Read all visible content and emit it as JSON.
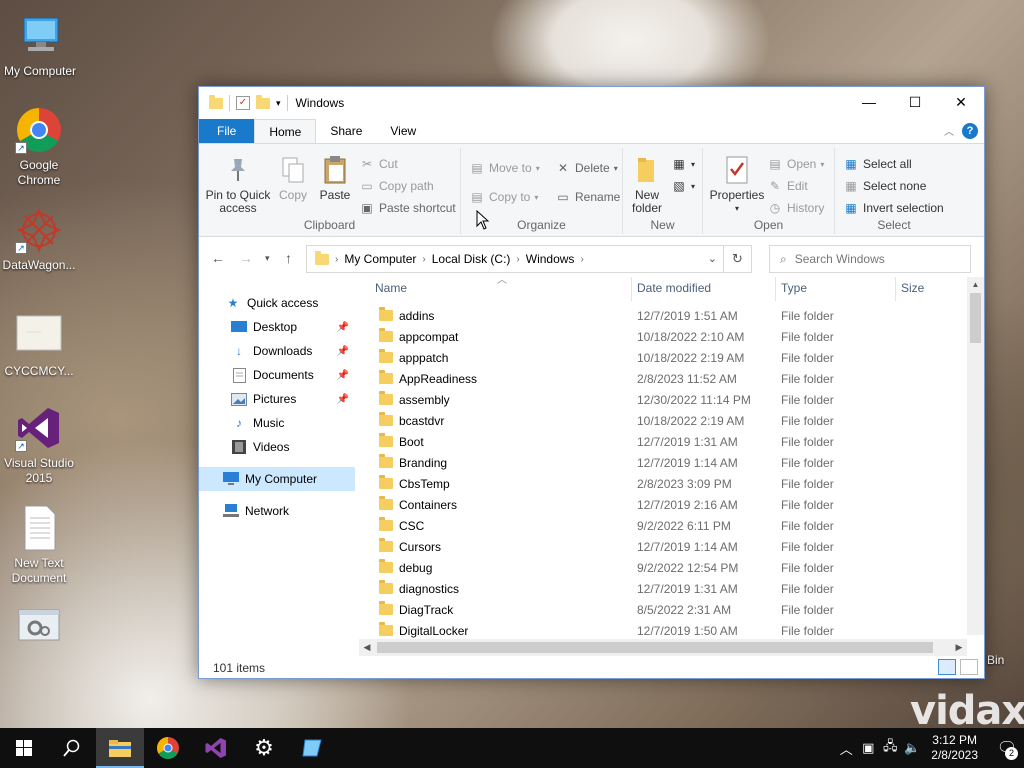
{
  "desktop": {
    "icons": [
      {
        "label": "My Computer"
      },
      {
        "label": "Google Chrome"
      },
      {
        "label": "DataWagon..."
      },
      {
        "label": "CYCCMCY..."
      },
      {
        "label": "Visual Studio 2015"
      },
      {
        "label": "New Text Document"
      }
    ],
    "recycle_bin_label": "Bin",
    "watermark": "vidaxz"
  },
  "window": {
    "title": "Windows",
    "tabs": [
      "File",
      "Home",
      "Share",
      "View"
    ],
    "help": "?",
    "ribbon": {
      "clipboard": {
        "label": "Clipboard",
        "pin": "Pin to Quick access",
        "copy": "Copy",
        "paste": "Paste",
        "cut": "Cut",
        "copy_path": "Copy path",
        "paste_shortcut": "Paste shortcut"
      },
      "organize": {
        "label": "Organize",
        "move_to": "Move to",
        "copy_to": "Copy to",
        "delete": "Delete",
        "rename": "Rename"
      },
      "new": {
        "label": "New",
        "new_folder": "New folder"
      },
      "open": {
        "label": "Open",
        "properties": "Properties",
        "open": "Open",
        "edit": "Edit",
        "history": "History"
      },
      "select": {
        "label": "Select",
        "select_all": "Select all",
        "select_none": "Select none",
        "invert": "Invert selection"
      }
    },
    "address": {
      "crumbs": [
        "My Computer",
        "Local Disk (C:)",
        "Windows"
      ],
      "search_placeholder": "Search Windows"
    },
    "nav": {
      "quick_access": "Quick access",
      "items": [
        {
          "label": "Desktop",
          "pinned": true
        },
        {
          "label": "Downloads",
          "pinned": true
        },
        {
          "label": "Documents",
          "pinned": true
        },
        {
          "label": "Pictures",
          "pinned": true
        },
        {
          "label": "Music",
          "pinned": false
        },
        {
          "label": "Videos",
          "pinned": false
        }
      ],
      "my_computer": "My Computer",
      "network": "Network"
    },
    "columns": {
      "name": "Name",
      "date": "Date modified",
      "type": "Type",
      "size": "Size"
    },
    "files": [
      {
        "name": "addins",
        "date": "12/7/2019 1:51 AM",
        "type": "File folder"
      },
      {
        "name": "appcompat",
        "date": "10/18/2022 2:10 AM",
        "type": "File folder"
      },
      {
        "name": "apppatch",
        "date": "10/18/2022 2:19 AM",
        "type": "File folder"
      },
      {
        "name": "AppReadiness",
        "date": "2/8/2023 11:52 AM",
        "type": "File folder"
      },
      {
        "name": "assembly",
        "date": "12/30/2022 11:14 PM",
        "type": "File folder"
      },
      {
        "name": "bcastdvr",
        "date": "10/18/2022 2:19 AM",
        "type": "File folder"
      },
      {
        "name": "Boot",
        "date": "12/7/2019 1:31 AM",
        "type": "File folder"
      },
      {
        "name": "Branding",
        "date": "12/7/2019 1:14 AM",
        "type": "File folder"
      },
      {
        "name": "CbsTemp",
        "date": "2/8/2023 3:09 PM",
        "type": "File folder"
      },
      {
        "name": "Containers",
        "date": "12/7/2019 2:16 AM",
        "type": "File folder"
      },
      {
        "name": "CSC",
        "date": "9/2/2022 6:11 PM",
        "type": "File folder"
      },
      {
        "name": "Cursors",
        "date": "12/7/2019 1:14 AM",
        "type": "File folder"
      },
      {
        "name": "debug",
        "date": "9/2/2022 12:54 PM",
        "type": "File folder"
      },
      {
        "name": "diagnostics",
        "date": "12/7/2019 1:31 AM",
        "type": "File folder"
      },
      {
        "name": "DiagTrack",
        "date": "8/5/2022 2:31 AM",
        "type": "File folder"
      },
      {
        "name": "DigitalLocker",
        "date": "12/7/2019 1:50 AM",
        "type": "File folder"
      }
    ],
    "status": {
      "count": "101 items"
    }
  },
  "taskbar": {
    "time": "3:12 PM",
    "date": "2/8/2023",
    "notifications": "2"
  },
  "colors": {
    "accent": "#1979ca",
    "selected": "#cce8ff",
    "folder": "#f6ce5f"
  }
}
